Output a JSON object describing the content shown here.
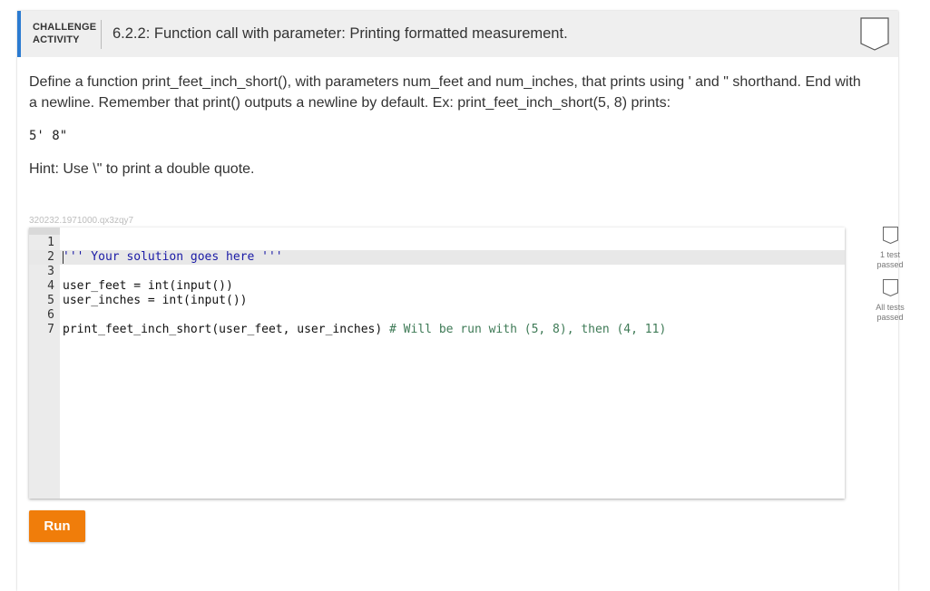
{
  "header": {
    "activity_type_line1": "CHALLENGE",
    "activity_type_line2": "ACTIVITY",
    "title": "6.2.2: Function call with parameter: Printing formatted measurement.",
    "badge_icon": "shield-badge-icon"
  },
  "instructions": {
    "text": "Define a function print_feet_inch_short(), with parameters num_feet and num_inches, that prints using ' and \" shorthand. End with a newline. Remember that print() outputs a newline by default. Ex: print_feet_inch_short(5, 8) prints:",
    "example_output": "5' 8\"",
    "hint": "Hint: Use \\\" to print a double quote."
  },
  "activity_id": "320232.1971000.qx3zqy7",
  "editor": {
    "lines": [
      {
        "num": "1",
        "text": ""
      },
      {
        "num": "2",
        "text": "''' Your solution goes here '''"
      },
      {
        "num": "3",
        "text": ""
      },
      {
        "num": "4",
        "text": "user_feet = int(input())"
      },
      {
        "num": "5",
        "text": "user_inches = int(input())"
      },
      {
        "num": "6",
        "text": ""
      },
      {
        "num": "7",
        "text": "print_feet_inch_short(user_feet, user_inches) # Will be run with (5, 8), then (4, 11)"
      }
    ],
    "active_line": 2
  },
  "tests": [
    {
      "label_line1": "1 test",
      "label_line2": "passed"
    },
    {
      "label_line1": "All tests",
      "label_line2": "passed"
    }
  ],
  "run_button": {
    "label": "Run"
  },
  "colors": {
    "accent": "#2b7bd1",
    "run": "#f07d0a"
  }
}
